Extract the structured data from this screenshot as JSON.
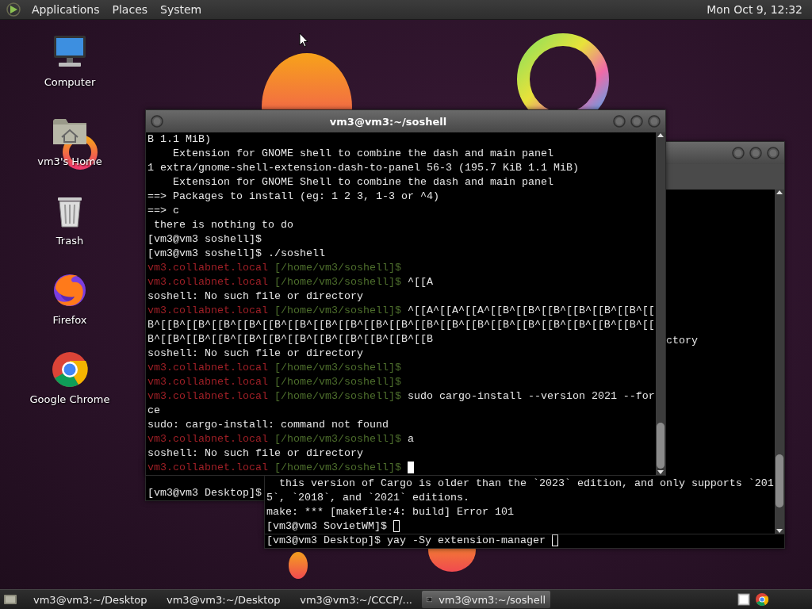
{
  "top_panel": {
    "menus": [
      "Applications",
      "Places",
      "System"
    ],
    "clock": "Mon Oct 9, 12:32"
  },
  "desktop_icons": [
    {
      "label": "Computer",
      "kind": "computer"
    },
    {
      "label": "vm3's Home",
      "kind": "home"
    },
    {
      "label": "Trash",
      "kind": "trash"
    },
    {
      "label": "Firefox",
      "kind": "fox"
    },
    {
      "label": "Google Chrome",
      "kind": "chrome"
    }
  ],
  "left_terminal": {
    "lines": [
      {
        "kind": "output",
        "text": "[vm3@vm3 Desktop]$"
      }
    ]
  },
  "bottom_terminal": {
    "lines": [
      {
        "kind": "output",
        "text": "[vm3@vm3 Desktop]$ yay -Sy extension-manager",
        "cursor": true,
        "cursor_filled": false
      }
    ]
  },
  "back_terminal": {
    "lines": [
      {
        "kind": "clipped",
        "text": "ctory"
      },
      {
        "kind": "blank"
      },
      {
        "kind": "blank"
      },
      {
        "kind": "blank"
      },
      {
        "kind": "blank"
      },
      {
        "kind": "blank"
      },
      {
        "kind": "blank"
      },
      {
        "kind": "blank"
      },
      {
        "kind": "blank"
      },
      {
        "kind": "blank"
      },
      {
        "kind": "output",
        "text": "  this version of Cargo is older than the `2023` edition, and only supports `201"
      },
      {
        "kind": "output",
        "text": "5`, `2018`, and `2021` editions."
      },
      {
        "kind": "output",
        "text": "make: *** [makefile:4: build] Error 101"
      },
      {
        "kind": "output",
        "text": "[vm3@vm3 SovietWM]$",
        "cursor": true,
        "cursor_filled": false
      }
    ]
  },
  "front_terminal": {
    "title": "vm3@vm3:~/soshell",
    "lines": [
      {
        "kind": "output",
        "text": "B 1.1 MiB)"
      },
      {
        "kind": "output",
        "text": "    Extension for GNOME shell to combine the dash and main panel"
      },
      {
        "kind": "output",
        "text": "1 extra/gnome-shell-extension-dash-to-panel 56-3 (195.7 KiB 1.1 MiB)"
      },
      {
        "kind": "output",
        "text": "    Extension for GNOME Shell to combine the dash and main panel"
      },
      {
        "kind": "output",
        "text": "==> Packages to install (eg: 1 2 3, 1-3 or ^4)"
      },
      {
        "kind": "output",
        "text": "==> c"
      },
      {
        "kind": "output",
        "text": " there is nothing to do"
      },
      {
        "kind": "output",
        "text": "[vm3@vm3 soshell]$"
      },
      {
        "kind": "output",
        "text": "[vm3@vm3 soshell]$ ./soshell"
      },
      {
        "kind": "prompt",
        "host": "vm3.collabnet.local",
        "path": "[/home/vm3/soshell]$"
      },
      {
        "kind": "prompt",
        "host": "vm3.collabnet.local",
        "path": "[/home/vm3/soshell]$",
        "command": "^[[A"
      },
      {
        "kind": "output",
        "text": "soshell: No such file or directory"
      },
      {
        "kind": "prompt",
        "host": "vm3.collabnet.local",
        "path": "[/home/vm3/soshell]$",
        "command": "^[[A^[[A^[[A^[[B^[[B^[[B^[[B^[[B^[[B^[["
      },
      {
        "kind": "output",
        "text": "B^[[B^[[B^[[B^[[B^[[B^[[B^[[B^[[B^[[B^[[B^[[B^[[B^[[B^[[B^[[B^[[B^[[B^[[B^[[B^[["
      },
      {
        "kind": "output",
        "text": "B^[[B^[[B^[[B^[[B^[[B^[[B^[[B^[[B^[[B^[[B^[[B"
      },
      {
        "kind": "output",
        "text": "soshell: No such file or directory"
      },
      {
        "kind": "prompt",
        "host": "vm3.collabnet.local",
        "path": "[/home/vm3/soshell]$"
      },
      {
        "kind": "prompt",
        "host": "vm3.collabnet.local",
        "path": "[/home/vm3/soshell]$"
      },
      {
        "kind": "prompt",
        "host": "vm3.collabnet.local",
        "path": "[/home/vm3/soshell]$",
        "command": "sudo cargo-install --version 2021 --for"
      },
      {
        "kind": "output",
        "text": "ce"
      },
      {
        "kind": "output",
        "text": "sudo: cargo-install: command not found"
      },
      {
        "kind": "prompt",
        "host": "vm3.collabnet.local",
        "path": "[/home/vm3/soshell]$",
        "command": "a"
      },
      {
        "kind": "output",
        "text": "soshell: No such file or directory"
      },
      {
        "kind": "prompt",
        "host": "vm3.collabnet.local",
        "path": "[/home/vm3/soshell]$",
        "cursor": true,
        "cursor_filled": true
      }
    ]
  },
  "taskbar": {
    "tasks": [
      {
        "label": "vm3@vm3:~/Desktop",
        "selected": false
      },
      {
        "label": "vm3@vm3:~/Desktop",
        "selected": false
      },
      {
        "label": "vm3@vm3:~/CCCP/...",
        "selected": false
      },
      {
        "label": "vm3@vm3:~/soshell",
        "selected": true
      }
    ]
  }
}
